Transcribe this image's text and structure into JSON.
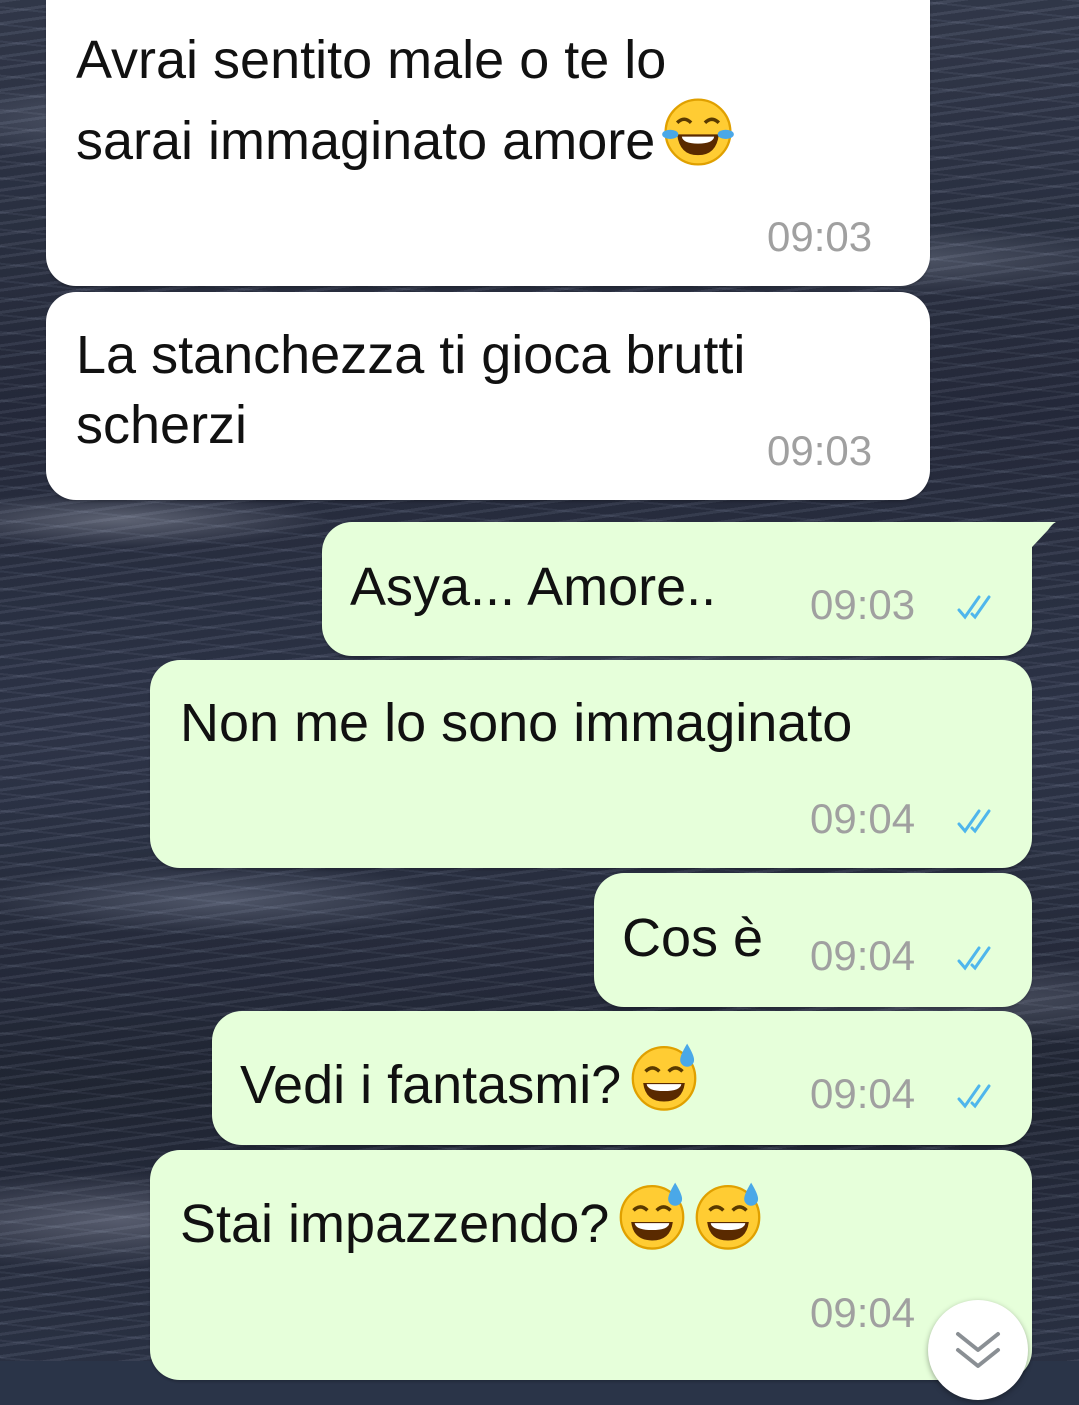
{
  "messages": [
    {
      "direction": "incoming",
      "text": "Avrai sentito male o te lo\nsarai immaginato amore",
      "emojis": [
        "joy-emoji"
      ],
      "time": "09:03"
    },
    {
      "direction": "incoming",
      "text": "La stanchezza ti gioca brutti\nscherzi",
      "emojis": [],
      "time": "09:03"
    },
    {
      "direction": "outgoing",
      "text": "Asya... Amore..",
      "emojis": [],
      "time": "09:03",
      "status": "read"
    },
    {
      "direction": "outgoing",
      "text": "Non me lo sono immaginato",
      "emojis": [],
      "time": "09:04",
      "status": "read"
    },
    {
      "direction": "outgoing",
      "text": "Cos è",
      "emojis": [],
      "time": "09:04",
      "status": "read"
    },
    {
      "direction": "outgoing",
      "text": "Vedi i fantasmi?",
      "emojis": [
        "grinning-sweat-emoji"
      ],
      "time": "09:04",
      "status": "read"
    },
    {
      "direction": "outgoing",
      "text": "Stai impazzendo?",
      "emojis": [
        "grinning-sweat-emoji",
        "grinning-sweat-emoji"
      ],
      "time": "09:04",
      "status": "read"
    }
  ],
  "scroll_button": {
    "icon": "double-chevron-down-icon"
  },
  "colors": {
    "incoming_bubble": "#ffffff",
    "outgoing_bubble": "#e6ffda",
    "timestamp": "#a0a0a0",
    "read_ticks": "#4fb6ec"
  }
}
